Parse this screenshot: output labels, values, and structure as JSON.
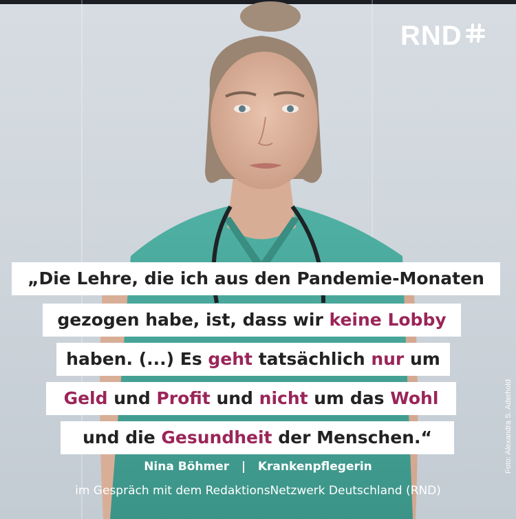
{
  "brand": {
    "logo_text": "RND"
  },
  "photo_credit": "Foto: Alexandra S. Aderhold",
  "quote": {
    "lines": [
      [
        {
          "text": "„Die Lehre, die ich aus den Pandemie-Monaten",
          "hl": false
        }
      ],
      [
        {
          "text": "gezogen habe, ist, dass wir ",
          "hl": false
        },
        {
          "text": "keine Lobby",
          "hl": true
        }
      ],
      [
        {
          "text": "haben. (...) Es ",
          "hl": false
        },
        {
          "text": "geht",
          "hl": true
        },
        {
          "text": " tatsächlich ",
          "hl": false
        },
        {
          "text": "nur",
          "hl": true
        },
        {
          "text": " um",
          "hl": false
        }
      ],
      [
        {
          "text": "Geld",
          "hl": true
        },
        {
          "text": " und ",
          "hl": false
        },
        {
          "text": "Profit",
          "hl": true
        },
        {
          "text": " und ",
          "hl": false
        },
        {
          "text": "nicht",
          "hl": true
        },
        {
          "text": " um das ",
          "hl": false
        },
        {
          "text": "Wohl",
          "hl": true
        }
      ],
      [
        {
          "text": "und die ",
          "hl": false
        },
        {
          "text": "Gesundheit",
          "hl": true
        },
        {
          "text": " der Menschen.“",
          "hl": false
        }
      ]
    ],
    "highlight_color": "#9a2558"
  },
  "attribution": {
    "name": "Nina Böhmer",
    "separator": "|",
    "role": "Krankenpflegerin",
    "source": "im Gespräch mit dem RedaktionsNetzwerk Deutschland (RND)"
  }
}
